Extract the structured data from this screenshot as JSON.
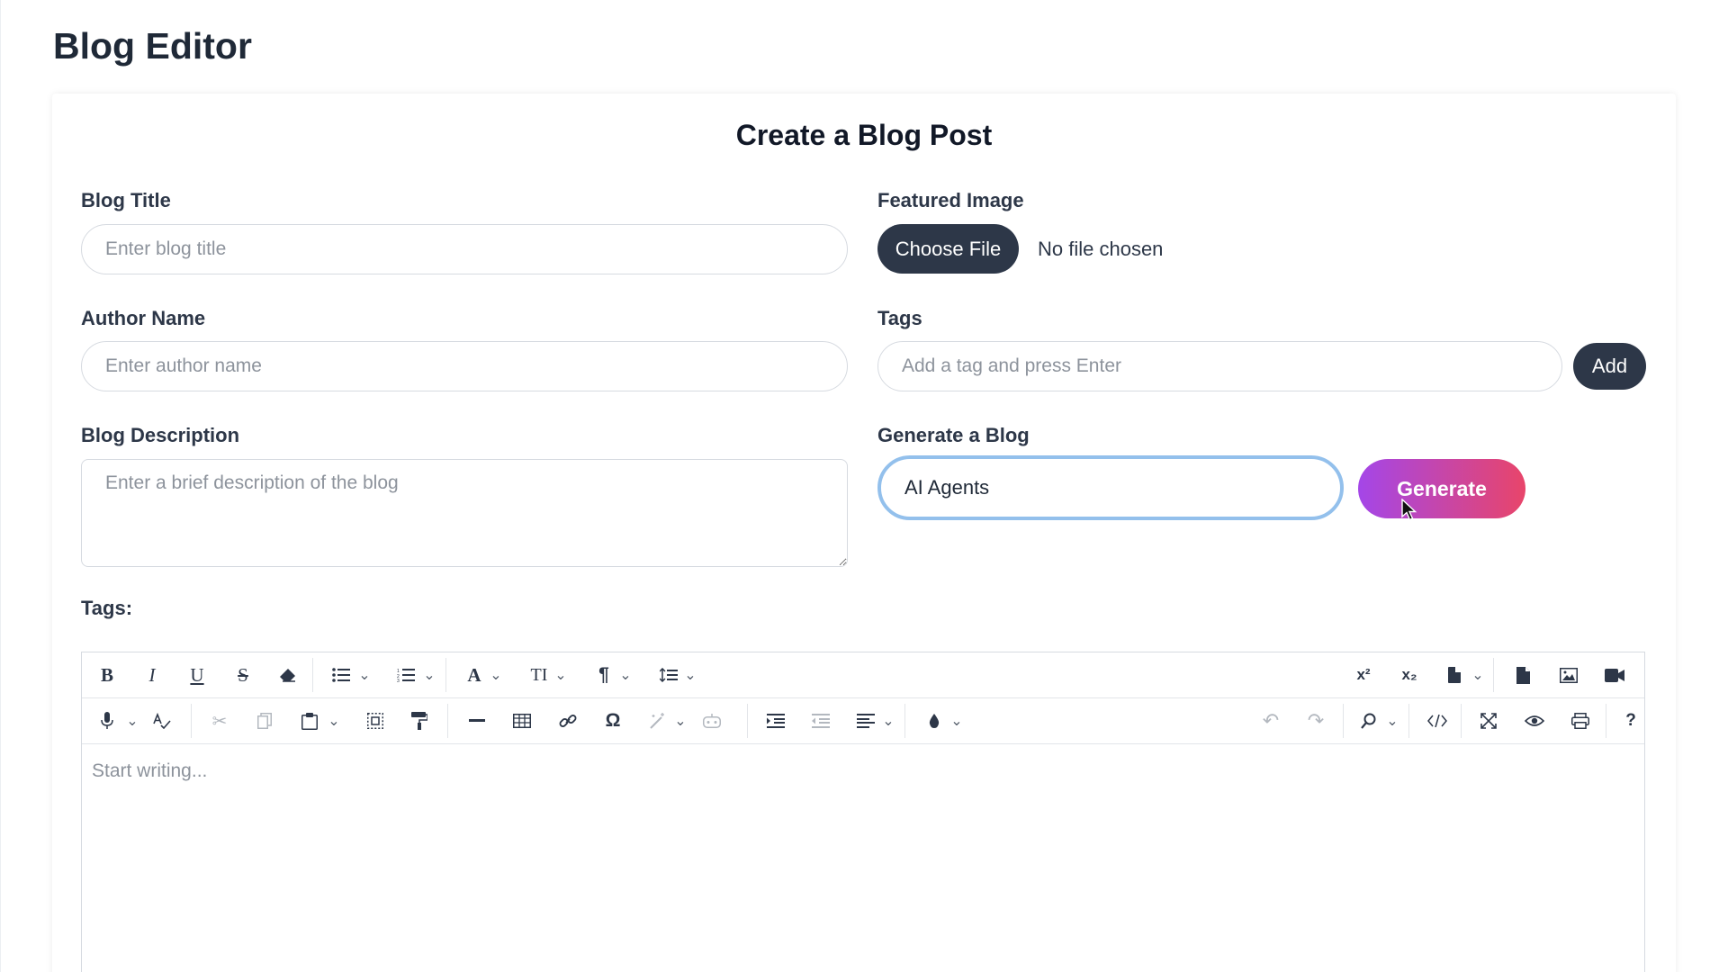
{
  "page": {
    "title": "Blog Editor"
  },
  "form": {
    "heading": "Create a Blog Post",
    "blog_title": {
      "label": "Blog Title",
      "placeholder": "Enter blog title",
      "value": ""
    },
    "featured_image": {
      "label": "Featured Image",
      "button_label": "Choose File",
      "status": "No file chosen"
    },
    "author_name": {
      "label": "Author Name",
      "placeholder": "Enter author name",
      "value": ""
    },
    "tags": {
      "label": "Tags",
      "placeholder": "Add a tag and press Enter",
      "add_label": "Add"
    },
    "blog_description": {
      "label": "Blog Description",
      "placeholder": "Enter a brief description of the blog"
    },
    "generate": {
      "label": "Generate a Blog",
      "value": "AI Agents",
      "button_label": "Generate"
    },
    "tags_list_label": "Tags:"
  },
  "editor": {
    "placeholder": "Start writing...",
    "toolbar_row1": [
      "bold",
      "italic",
      "underline",
      "strikethrough",
      "eraser",
      "bulleted-list",
      "numbered-list",
      "font-color",
      "font-size",
      "paragraph",
      "line-height",
      "superscript",
      "subscript",
      "page-break",
      "document",
      "image",
      "video"
    ],
    "toolbar_row2": [
      "microphone",
      "spellcheck",
      "cut",
      "copy",
      "paste",
      "select-all",
      "format-painter",
      "horizontal-rule",
      "table",
      "link",
      "special-character",
      "magic-wand",
      "ai-assistant",
      "indent",
      "outdent",
      "align",
      "fill-color",
      "undo",
      "redo",
      "find",
      "source-code",
      "fullscreen",
      "preview",
      "print",
      "help"
    ],
    "labels": {
      "bold": "B",
      "italic": "I",
      "underline": "U",
      "strike": "S",
      "font": "A",
      "font_size": "TI",
      "paragraph": "¶",
      "superscript": "x²",
      "subscript": "x₂",
      "special": "Ω",
      "help": "?"
    }
  },
  "colors": {
    "accent_dark": "#2d3748",
    "gradient_start": "#a446e8",
    "gradient_end": "#e8456a",
    "focus_ring": "#93c0ec"
  }
}
